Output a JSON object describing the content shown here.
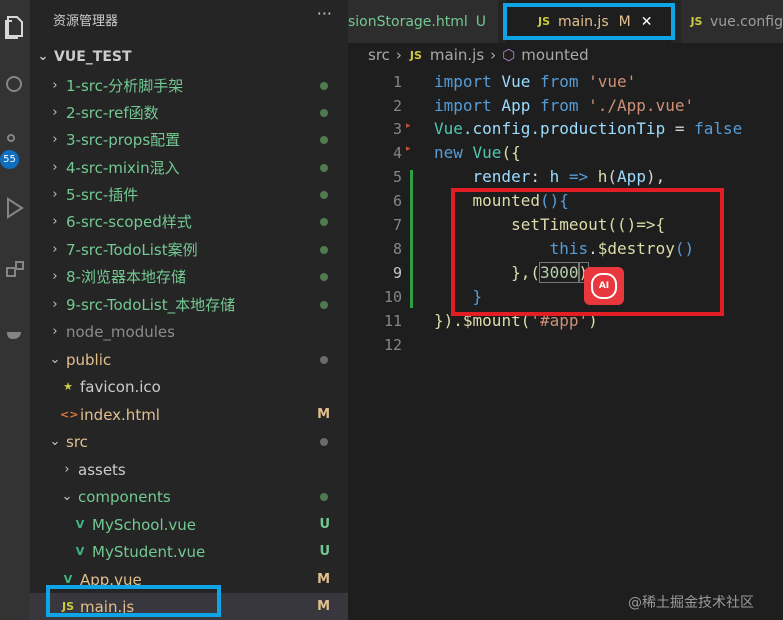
{
  "explorer": {
    "title": "资源管理器",
    "more": "···",
    "project": "VUE_TEST",
    "items": [
      {
        "label": "1-src-分析脚手架",
        "twisty": "›",
        "status": "",
        "color": "green"
      },
      {
        "label": "2-src-ref函数",
        "twisty": "›",
        "status": "",
        "color": "green"
      },
      {
        "label": "3-src-props配置",
        "twisty": "›",
        "status": "",
        "color": "green"
      },
      {
        "label": "4-src-mixin混入",
        "twisty": "›",
        "status": "",
        "color": "green"
      },
      {
        "label": "5-src-插件",
        "twisty": "›",
        "status": "",
        "color": "green"
      },
      {
        "label": "6-src-scoped样式",
        "twisty": "›",
        "status": "",
        "color": "green"
      },
      {
        "label": "7-src-TodoList案例",
        "twisty": "›",
        "status": "",
        "color": "green"
      },
      {
        "label": "8-浏览器本地存储",
        "twisty": "›",
        "status": "",
        "color": "green"
      },
      {
        "label": "9-src-TodoList_本地存储",
        "twisty": "›",
        "status": "",
        "color": "green"
      },
      {
        "label": "node_modules",
        "twisty": "›",
        "status": "",
        "color": "grey"
      },
      {
        "label": "public",
        "twisty": "⌄",
        "status": "",
        "color": "orange"
      },
      {
        "label": "favicon.ico",
        "twisty": "",
        "status": "",
        "color": "white",
        "icon": "★"
      },
      {
        "label": "index.html",
        "twisty": "",
        "status": "M",
        "color": "orange",
        "icon": "<>"
      },
      {
        "label": "src",
        "twisty": "⌄",
        "status": "",
        "color": "orange"
      },
      {
        "label": "assets",
        "twisty": "›",
        "status": "",
        "color": "white"
      },
      {
        "label": "components",
        "twisty": "⌄",
        "status": "",
        "color": "green"
      },
      {
        "label": "MySchool.vue",
        "twisty": "",
        "status": "U",
        "color": "green",
        "icon": "V"
      },
      {
        "label": "MyStudent.vue",
        "twisty": "",
        "status": "U",
        "color": "green",
        "icon": "V"
      },
      {
        "label": "App.vue",
        "twisty": "",
        "status": "M",
        "color": "orange",
        "icon": "V"
      },
      {
        "label": "main.js",
        "twisty": "",
        "status": "M",
        "color": "orange",
        "icon": "JS"
      }
    ]
  },
  "activity": {
    "badge": "55"
  },
  "tabs": [
    {
      "label": "sionStorage.html",
      "status": "U"
    },
    {
      "icon": "JS",
      "label": "main.js",
      "status": "M",
      "close": "✕"
    },
    {
      "icon": "JS",
      "label": "vue.config"
    }
  ],
  "breadcrumb": {
    "folder": "src",
    "sep1": "›",
    "icon": "JS",
    "file": "main.js",
    "sep2": "›",
    "symbol": "mounted"
  },
  "editor": {
    "line_numbers": [
      "1",
      "2",
      "3",
      "4",
      "5",
      "6",
      "7",
      "8",
      "9",
      "10",
      "11",
      "12"
    ],
    "lines": [
      {
        "t1": "import",
        "t2": " Vue ",
        "t3": "from",
        "t4": " 'vue'"
      },
      {
        "t1": "import",
        "t2": " App ",
        "t3": "from",
        "t4": " './App.vue'"
      },
      {
        "t1": "Vue",
        "t2": ".config.",
        "t3": "productionTip",
        "t4": " = ",
        "t5": "false"
      },
      {
        "t1": "new",
        "t2": " Vue",
        "t3": "({"
      },
      {
        "t1": "    render",
        "t2": ": ",
        "t3": "h",
        "t4": " => ",
        "t5": "h",
        "t6": "(",
        "t7": "App",
        "t8": "),"
      },
      {
        "t1": "    mounted",
        "t2": "(){"
      },
      {
        "t1": "        setTimeout",
        "t2": "(()=>{"
      },
      {
        "t1": "            this",
        "t2": ".",
        "t3": "$destroy",
        "t4": "()"
      },
      {
        "t1": "        },(",
        "t2": "3000",
        "t3": ")"
      },
      {
        "t1": "    }"
      },
      {
        "t1": "}).",
        "t2": "$mount",
        "t3": "(",
        "t4": "'#app'",
        "t5": ")"
      },
      {
        "t1": ""
      }
    ]
  },
  "ai_badge": "AI",
  "watermark": "@稀土掘金技术社区",
  "colors": {
    "red_highlight": "#e21d23",
    "blue_highlight": "#0ea4e6"
  }
}
